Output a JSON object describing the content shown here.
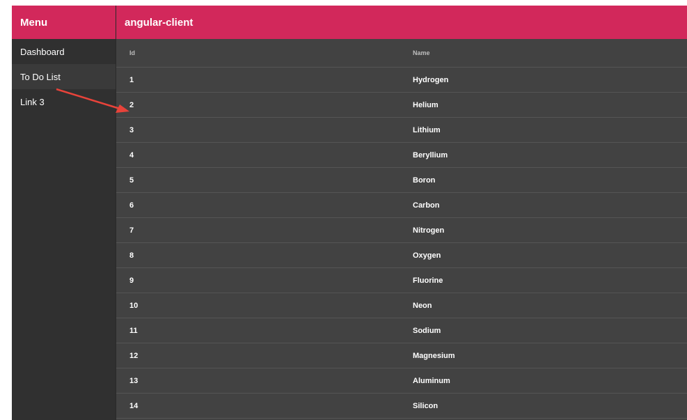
{
  "sidebar": {
    "title": "Menu",
    "items": [
      {
        "label": "Dashboard"
      },
      {
        "label": "To Do List"
      },
      {
        "label": "Link 3"
      }
    ]
  },
  "toolbar": {
    "title": "angular-client"
  },
  "table": {
    "columns": [
      "Id",
      "Name"
    ],
    "rows": [
      [
        "1",
        "Hydrogen"
      ],
      [
        "2",
        "Helium"
      ],
      [
        "3",
        "Lithium"
      ],
      [
        "4",
        "Beryllium"
      ],
      [
        "5",
        "Boron"
      ],
      [
        "6",
        "Carbon"
      ],
      [
        "7",
        "Nitrogen"
      ],
      [
        "8",
        "Oxygen"
      ],
      [
        "9",
        "Fluorine"
      ],
      [
        "10",
        "Neon"
      ],
      [
        "11",
        "Sodium"
      ],
      [
        "12",
        "Magnesium"
      ],
      [
        "13",
        "Aluminum"
      ],
      [
        "14",
        "Silicon"
      ]
    ]
  },
  "colors": {
    "accent": "#d2285b",
    "sidebar_bg": "#303030",
    "main_bg": "#424242",
    "annotation_arrow": "#e8433a"
  }
}
